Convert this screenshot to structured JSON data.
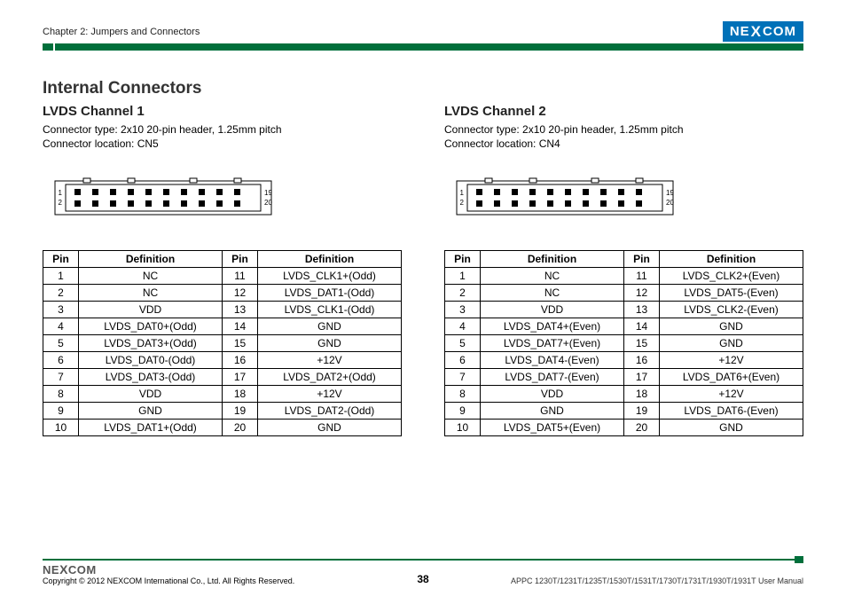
{
  "header": {
    "chapter": "Chapter 2: Jumpers and Connectors",
    "logo_left": "NE",
    "logo_x": "X",
    "logo_right": "COM"
  },
  "title": "Internal Connectors",
  "channel1": {
    "title": "LVDS Channel 1",
    "desc1": "Connector type: 2x10 20-pin header, 1.25mm pitch",
    "desc2": "Connector location: CN5",
    "pinlabels": {
      "tl": "1",
      "bl": "2",
      "tr": "19",
      "br": "20"
    }
  },
  "channel2": {
    "title": "LVDS Channel 2",
    "desc1": "Connector type: 2x10 20-pin header, 1.25mm pitch",
    "desc2": "Connector location: CN4",
    "pinlabels": {
      "tl": "1",
      "bl": "2",
      "tr": "19",
      "br": "20"
    }
  },
  "table_headers": {
    "pin": "Pin",
    "def": "Definition"
  },
  "table1": [
    [
      "1",
      "NC",
      "11",
      "LVDS_CLK1+(Odd)"
    ],
    [
      "2",
      "NC",
      "12",
      "LVDS_DAT1-(Odd)"
    ],
    [
      "3",
      "VDD",
      "13",
      "LVDS_CLK1-(Odd)"
    ],
    [
      "4",
      "LVDS_DAT0+(Odd)",
      "14",
      "GND"
    ],
    [
      "5",
      "LVDS_DAT3+(Odd)",
      "15",
      "GND"
    ],
    [
      "6",
      "LVDS_DAT0-(Odd)",
      "16",
      "+12V"
    ],
    [
      "7",
      "LVDS_DAT3-(Odd)",
      "17",
      "LVDS_DAT2+(Odd)"
    ],
    [
      "8",
      "VDD",
      "18",
      "+12V"
    ],
    [
      "9",
      "GND",
      "19",
      "LVDS_DAT2-(Odd)"
    ],
    [
      "10",
      "LVDS_DAT1+(Odd)",
      "20",
      "GND"
    ]
  ],
  "table2": [
    [
      "1",
      "NC",
      "11",
      "LVDS_CLK2+(Even)"
    ],
    [
      "2",
      "NC",
      "12",
      "LVDS_DAT5-(Even)"
    ],
    [
      "3",
      "VDD",
      "13",
      "LVDS_CLK2-(Even)"
    ],
    [
      "4",
      "LVDS_DAT4+(Even)",
      "14",
      "GND"
    ],
    [
      "5",
      "LVDS_DAT7+(Even)",
      "15",
      "GND"
    ],
    [
      "6",
      "LVDS_DAT4-(Even)",
      "16",
      "+12V"
    ],
    [
      "7",
      "LVDS_DAT7-(Even)",
      "17",
      "LVDS_DAT6+(Even)"
    ],
    [
      "8",
      "VDD",
      "18",
      "+12V"
    ],
    [
      "9",
      "GND",
      "19",
      "LVDS_DAT6-(Even)"
    ],
    [
      "10",
      "LVDS_DAT5+(Even)",
      "20",
      "GND"
    ]
  ],
  "footer": {
    "logo_left": "NE",
    "logo_x": "X",
    "logo_right": "COM",
    "copyright": "Copyright © 2012 NEXCOM International Co., Ltd. All Rights Reserved.",
    "page": "38",
    "right": "APPC 1230T/1231T/1235T/1530T/1531T/1730T/1731T/1930T/1931T User Manual"
  },
  "chart_data": null
}
